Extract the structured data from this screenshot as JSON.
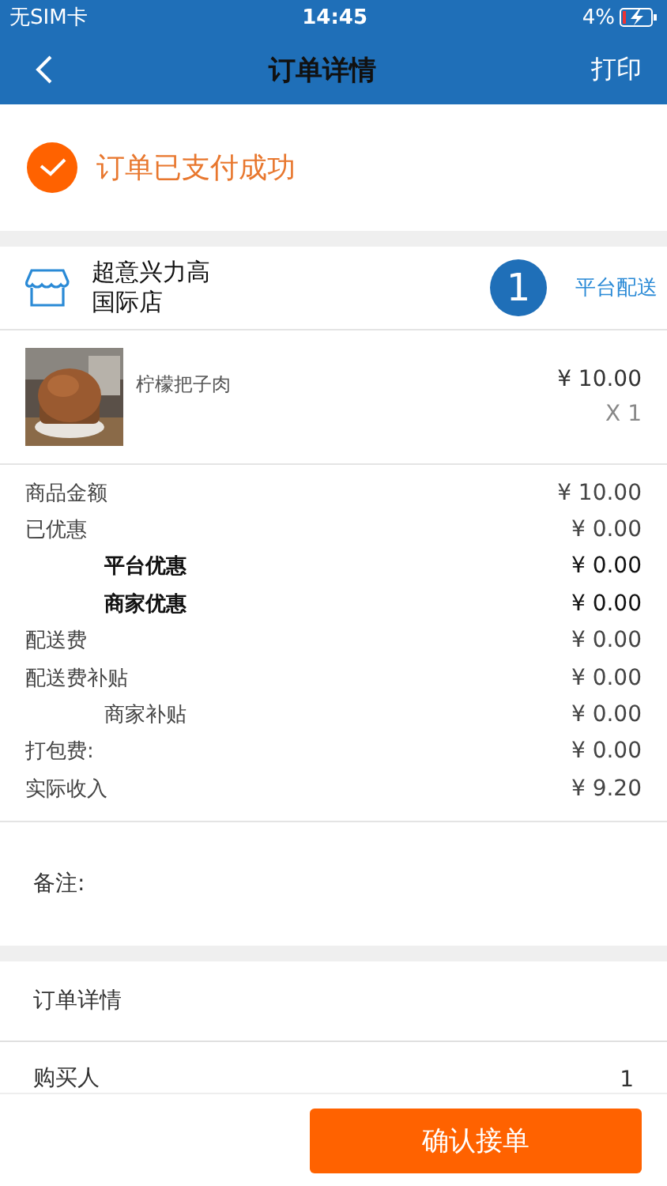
{
  "status_bar": {
    "carrier": "无SIM卡",
    "time": "14:45",
    "battery": "4%"
  },
  "nav": {
    "title": "订单详情",
    "action": "打印"
  },
  "payment_status": {
    "text": "订单已支付成功"
  },
  "store": {
    "name_lines": [
      "超意兴力高",
      "国际店"
    ],
    "badge": "1",
    "delivery": "平台配送"
  },
  "items": [
    {
      "kind": "picture",
      "name": "柠檬把子肉",
      "price": "¥ 10.00",
      "quantity": "X 1"
    }
  ],
  "summary": [
    {
      "kind": "main",
      "label": "商品金额",
      "value": "¥ 10.00"
    },
    {
      "kind": "main",
      "label": "已优惠",
      "value": "¥ 0.00"
    },
    {
      "kind": "discount",
      "label": "平台优惠",
      "value": "¥ 0.00"
    },
    {
      "kind": "discount",
      "label": "商家优惠",
      "value": "¥ 0.00"
    },
    {
      "kind": "main",
      "label": "配送费",
      "value": "¥ 0.00"
    },
    {
      "kind": "main",
      "label": "配送费补贴",
      "value": "¥ 0.00"
    },
    {
      "kind": "subsidy",
      "label": "商家补贴",
      "value": "¥ 0.00"
    },
    {
      "kind": "main",
      "label": "打包费:",
      "value": "¥ 0.00"
    },
    {
      "kind": "main",
      "label": "实际收入",
      "value": "¥ 9.20"
    }
  ],
  "remark": {
    "label": "备注:"
  },
  "order_details": {
    "title": "订单详情",
    "rows": [
      {
        "label": "购买人",
        "value": "1"
      }
    ]
  },
  "confirm_button": "确认接单"
}
